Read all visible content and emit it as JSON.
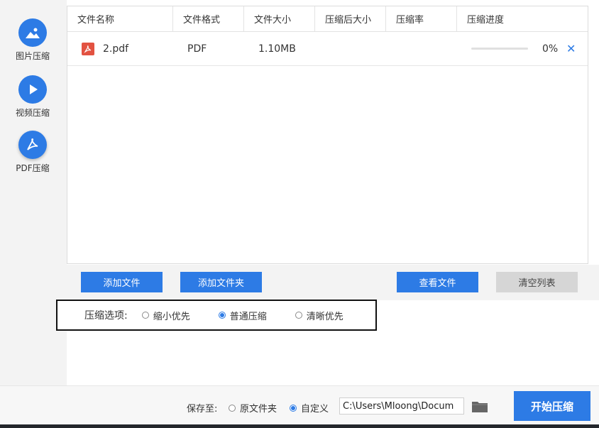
{
  "sidebar": {
    "items": [
      {
        "label": "图片压缩",
        "icon": "image-icon"
      },
      {
        "label": "视频压缩",
        "icon": "play-icon"
      },
      {
        "label": "PDF压缩",
        "icon": "pdf-icon"
      }
    ]
  },
  "table": {
    "columns": [
      "文件名称",
      "文件格式",
      "文件大小",
      "压缩后大小",
      "压缩率",
      "压缩进度"
    ],
    "rows": [
      {
        "name": "2.pdf",
        "format": "PDF",
        "size": "1.10MB",
        "compressed_size": "",
        "ratio": "",
        "progress": "0%",
        "progress_value": 0
      }
    ]
  },
  "buttons": {
    "add_file": "添加文件",
    "add_folder": "添加文件夹",
    "view_file": "查看文件",
    "clear_list": "清空列表"
  },
  "options": {
    "label": "压缩选项:",
    "items": [
      "缩小优先",
      "普通压缩",
      "清晰优先"
    ],
    "selected": "普通压缩"
  },
  "save": {
    "label": "保存至:",
    "option_original": "原文件夹",
    "option_custom": "自定义",
    "selected": "自定义",
    "path": "C:\\Users\\Mloong\\Docum"
  },
  "start_button": "开始压缩",
  "colors": {
    "accent": "#2d7be5",
    "pdf_red": "#e25241",
    "disabled_gray": "#d6d6d6"
  }
}
